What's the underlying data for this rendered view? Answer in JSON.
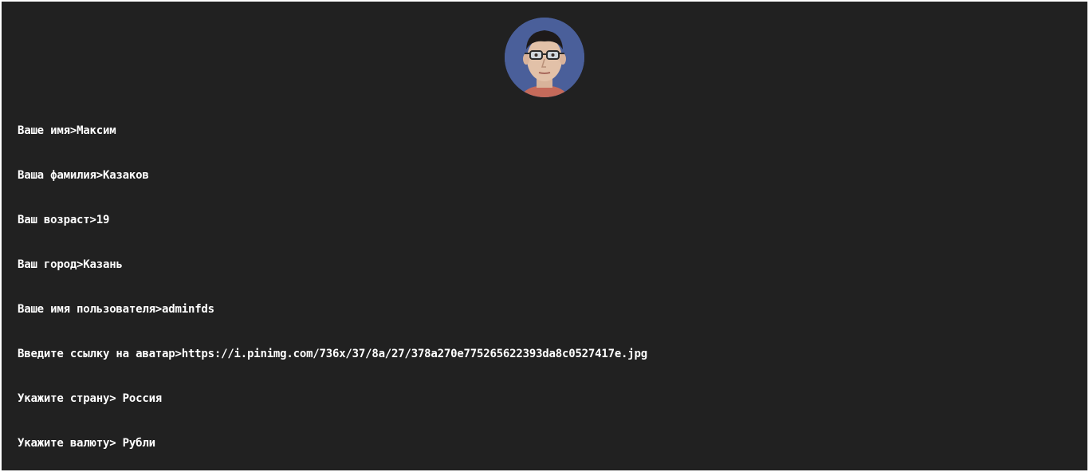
{
  "colors": {
    "background": "#212121",
    "text": "#ffffff",
    "avatar_bg": "#4a5f9a"
  },
  "avatar": {
    "icon": "user-avatar-photo"
  },
  "fields": [
    {
      "label": "Ваше имя>",
      "value": "Максим"
    },
    {
      "label": "Ваша фамилия>",
      "value": "Казаков"
    },
    {
      "label": "Ваш возраст>",
      "value": "19"
    },
    {
      "label": "Ваш город>",
      "value": "Казань"
    },
    {
      "label": "Ваше имя пользователя>",
      "value": "adminfds"
    },
    {
      "label": "Введите ссылку на аватар>",
      "value": "https://i.pinimg.com/736x/37/8a/27/378a270e775265622393da8c0527417e.jpg"
    },
    {
      "label": "Укажите страну>",
      "value": " Россия"
    },
    {
      "label": "Укажите валюту>",
      "value": " Рубли"
    }
  ]
}
